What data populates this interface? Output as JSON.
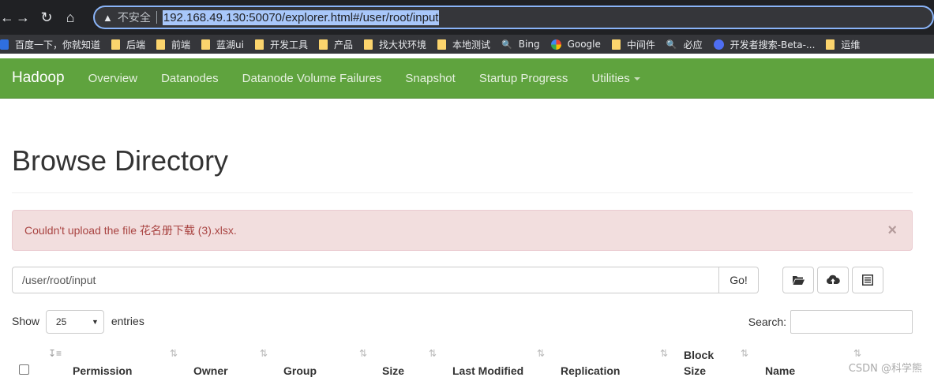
{
  "browser": {
    "back": "←",
    "forward": "→",
    "reload": "↻",
    "home": "⌂",
    "security_label": "不安全",
    "url": "192.168.49.130:50070/explorer.html#/user/root/input"
  },
  "bookmarks": [
    {
      "label": "百度一下，你就知道",
      "icon": "baidu-icon"
    },
    {
      "label": "后端",
      "icon": "folder-icon"
    },
    {
      "label": "前端",
      "icon": "folder-icon"
    },
    {
      "label": "蓝湖ui",
      "icon": "folder-icon"
    },
    {
      "label": "开发工具",
      "icon": "folder-icon"
    },
    {
      "label": "产品",
      "icon": "folder-icon"
    },
    {
      "label": "找大状环境",
      "icon": "folder-icon"
    },
    {
      "label": "本地测试",
      "icon": "folder-icon"
    },
    {
      "label": "Bing",
      "icon": "search-icon"
    },
    {
      "label": "Google",
      "icon": "google-icon"
    },
    {
      "label": "中间件",
      "icon": "folder-icon"
    },
    {
      "label": "必应",
      "icon": "search-icon"
    },
    {
      "label": "开发者搜索-Beta-...",
      "icon": "dev-search-icon"
    },
    {
      "label": "运维",
      "icon": "folder-icon"
    }
  ],
  "navbar": {
    "brand": "Hadoop",
    "links": [
      "Overview",
      "Datanodes",
      "Datanode Volume Failures",
      "Snapshot",
      "Startup Progress",
      "Utilities"
    ]
  },
  "page": {
    "title": "Browse Directory",
    "alert": "Couldn't upload the file 花名册下载 (3).xlsx.",
    "alert_close": "×",
    "path_value": "/user/root/input",
    "go_label": "Go!",
    "show_label": "Show",
    "entries_value": "25",
    "entries_label": "entries",
    "search_label": "Search:"
  },
  "table": {
    "headers": [
      "Permission",
      "Owner",
      "Group",
      "Size",
      "Last Modified",
      "Replication",
      "Block",
      "Size",
      "Name"
    ]
  },
  "watermark": "CSDN @科学熊",
  "colors": {
    "navbar": "#5fa33e",
    "alert_bg": "#f2dede",
    "alert_text": "#a94442"
  }
}
